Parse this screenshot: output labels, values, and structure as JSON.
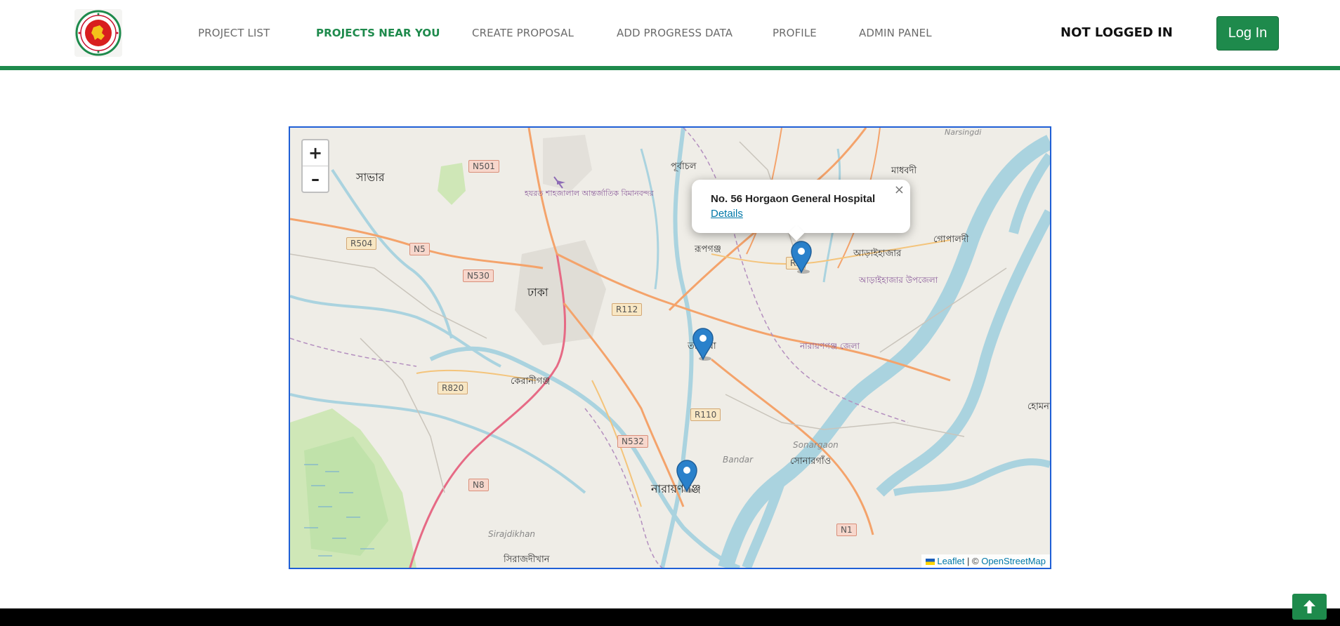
{
  "nav": {
    "items": [
      {
        "label": "PROJECT LIST",
        "active": false
      },
      {
        "label": "PROJECTS NEAR YOU",
        "active": true
      },
      {
        "label": "CREATE PROPOSAL",
        "active": false
      },
      {
        "label": "ADD PROGRESS DATA",
        "active": false
      },
      {
        "label": "PROFILE",
        "active": false
      },
      {
        "label": "ADMIN PANEL",
        "active": false
      }
    ],
    "status": "NOT LOGGED IN",
    "login_label": "Log In"
  },
  "map": {
    "zoom_in": "+",
    "zoom_out": "–",
    "places": {
      "savar": "সাভার",
      "dhaka": "ঢাকা",
      "purbachal": "পূর্বাচল",
      "madhabdi": "মাধবদী",
      "rupganj": "রূপগঞ্জ",
      "araihazar": "আড়াইহাজার",
      "araihazar_upazila": "আড়াইহাজার উপজেলা",
      "gopaldi": "গোপালদী",
      "narayanganj_district": "নারায়ণগঞ্জ জেলা",
      "keraniganj": "কেরানীগঞ্জ",
      "sonargaon_en": "Sonargaon",
      "sonargaon": "সোনারগাঁও",
      "bandar": "Bandar",
      "narayanganj": "নারায়ণগঞ্জ",
      "sirajdikhan_en": "Sirajdikhan",
      "sirajdikhan": "সিরাজদীখান",
      "homna": "হোমনা",
      "narsingdi": "Narsingdi",
      "airport": "হযরত শাহজালাল আন্তর্জাতিক বিমানবন্দর",
      "tarabo": "তারাবো"
    },
    "roads": [
      "N501",
      "R504",
      "N5",
      "N530",
      "R112",
      "R820",
      "R110",
      "N532",
      "N8",
      "N1",
      "R2"
    ],
    "popup": {
      "title": "No. 56 Horgaon General Hospital",
      "link": "Details",
      "close": "×"
    },
    "attribution": {
      "leaflet": "Leaflet",
      "separator": "| ©",
      "osm": "OpenStreetMap"
    },
    "markers": [
      "project-marker-araihazar",
      "project-marker-tarabo",
      "project-marker-narayanganj"
    ]
  },
  "colors": {
    "brand_green": "#1e8a4c",
    "map_border": "#1f5fd6",
    "marker_blue": "#2a81cb"
  }
}
